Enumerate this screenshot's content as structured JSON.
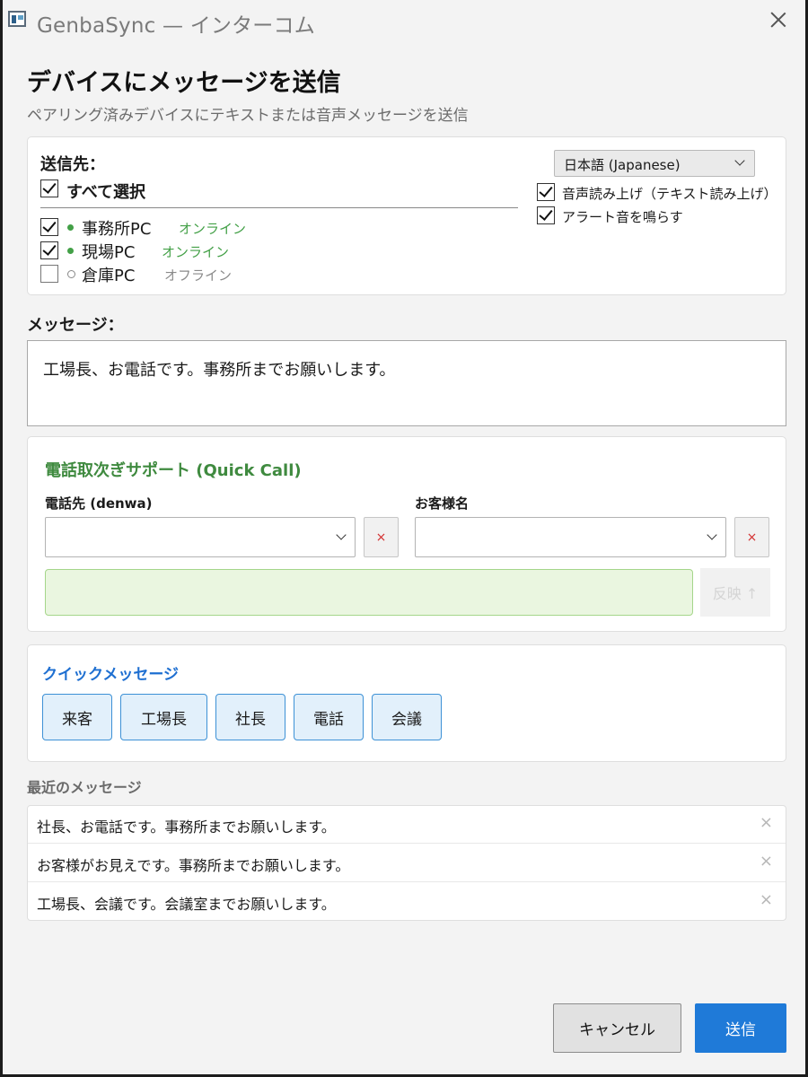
{
  "window": {
    "title": "GenbaSync — インターコム"
  },
  "header": {
    "title": "デバイスにメッセージを送信",
    "subtitle": "ペアリング済みデバイスにテキストまたは音声メッセージを送信"
  },
  "recipients": {
    "label": "送信先：",
    "select_all_label": "すべて選択",
    "select_all_checked": true,
    "devices": [
      {
        "name": "事務所PC",
        "status": "オンライン",
        "online": true,
        "checked": true
      },
      {
        "name": "現場PC",
        "status": "オンライン",
        "online": true,
        "checked": true
      },
      {
        "name": "倉庫PC",
        "status": "オフライン",
        "online": false,
        "checked": false
      }
    ]
  },
  "options": {
    "language": "日本語 (Japanese)",
    "tts_label": "音声読み上げ（テキスト読み上げ）",
    "tts_checked": true,
    "alert_label": "アラート音を鳴らす",
    "alert_checked": true
  },
  "message": {
    "label": "メッセージ：",
    "value": "工場長、お電話です。事務所までお願いします。"
  },
  "quick_call": {
    "title": "電話取次ぎサポート (Quick Call)",
    "phone_label": "電話先 (denwa)",
    "phone_value": "",
    "customer_label": "お客様名",
    "customer_value": "",
    "clear_symbol": "×",
    "preview_value": "",
    "apply_label": "反映 ↑"
  },
  "quick_messages": {
    "title": "クイックメッセージ",
    "items": [
      "来客",
      "工場長",
      "社長",
      "電話",
      "会議"
    ]
  },
  "recent": {
    "label": "最近のメッセージ",
    "items": [
      "社長、お電話です。事務所までお願いします。",
      "お客様がお見えです。事務所までお願いします。",
      "工場長、会議です。会議室までお願いします。"
    ],
    "delete_symbol": "×"
  },
  "footer": {
    "cancel_label": "キャンセル",
    "send_label": "送信"
  },
  "colors": {
    "accent": "#1f7ad8",
    "online": "#43a047",
    "quick_call_title": "#3f8a3f",
    "quick_msg_title": "#1e6fd1"
  }
}
